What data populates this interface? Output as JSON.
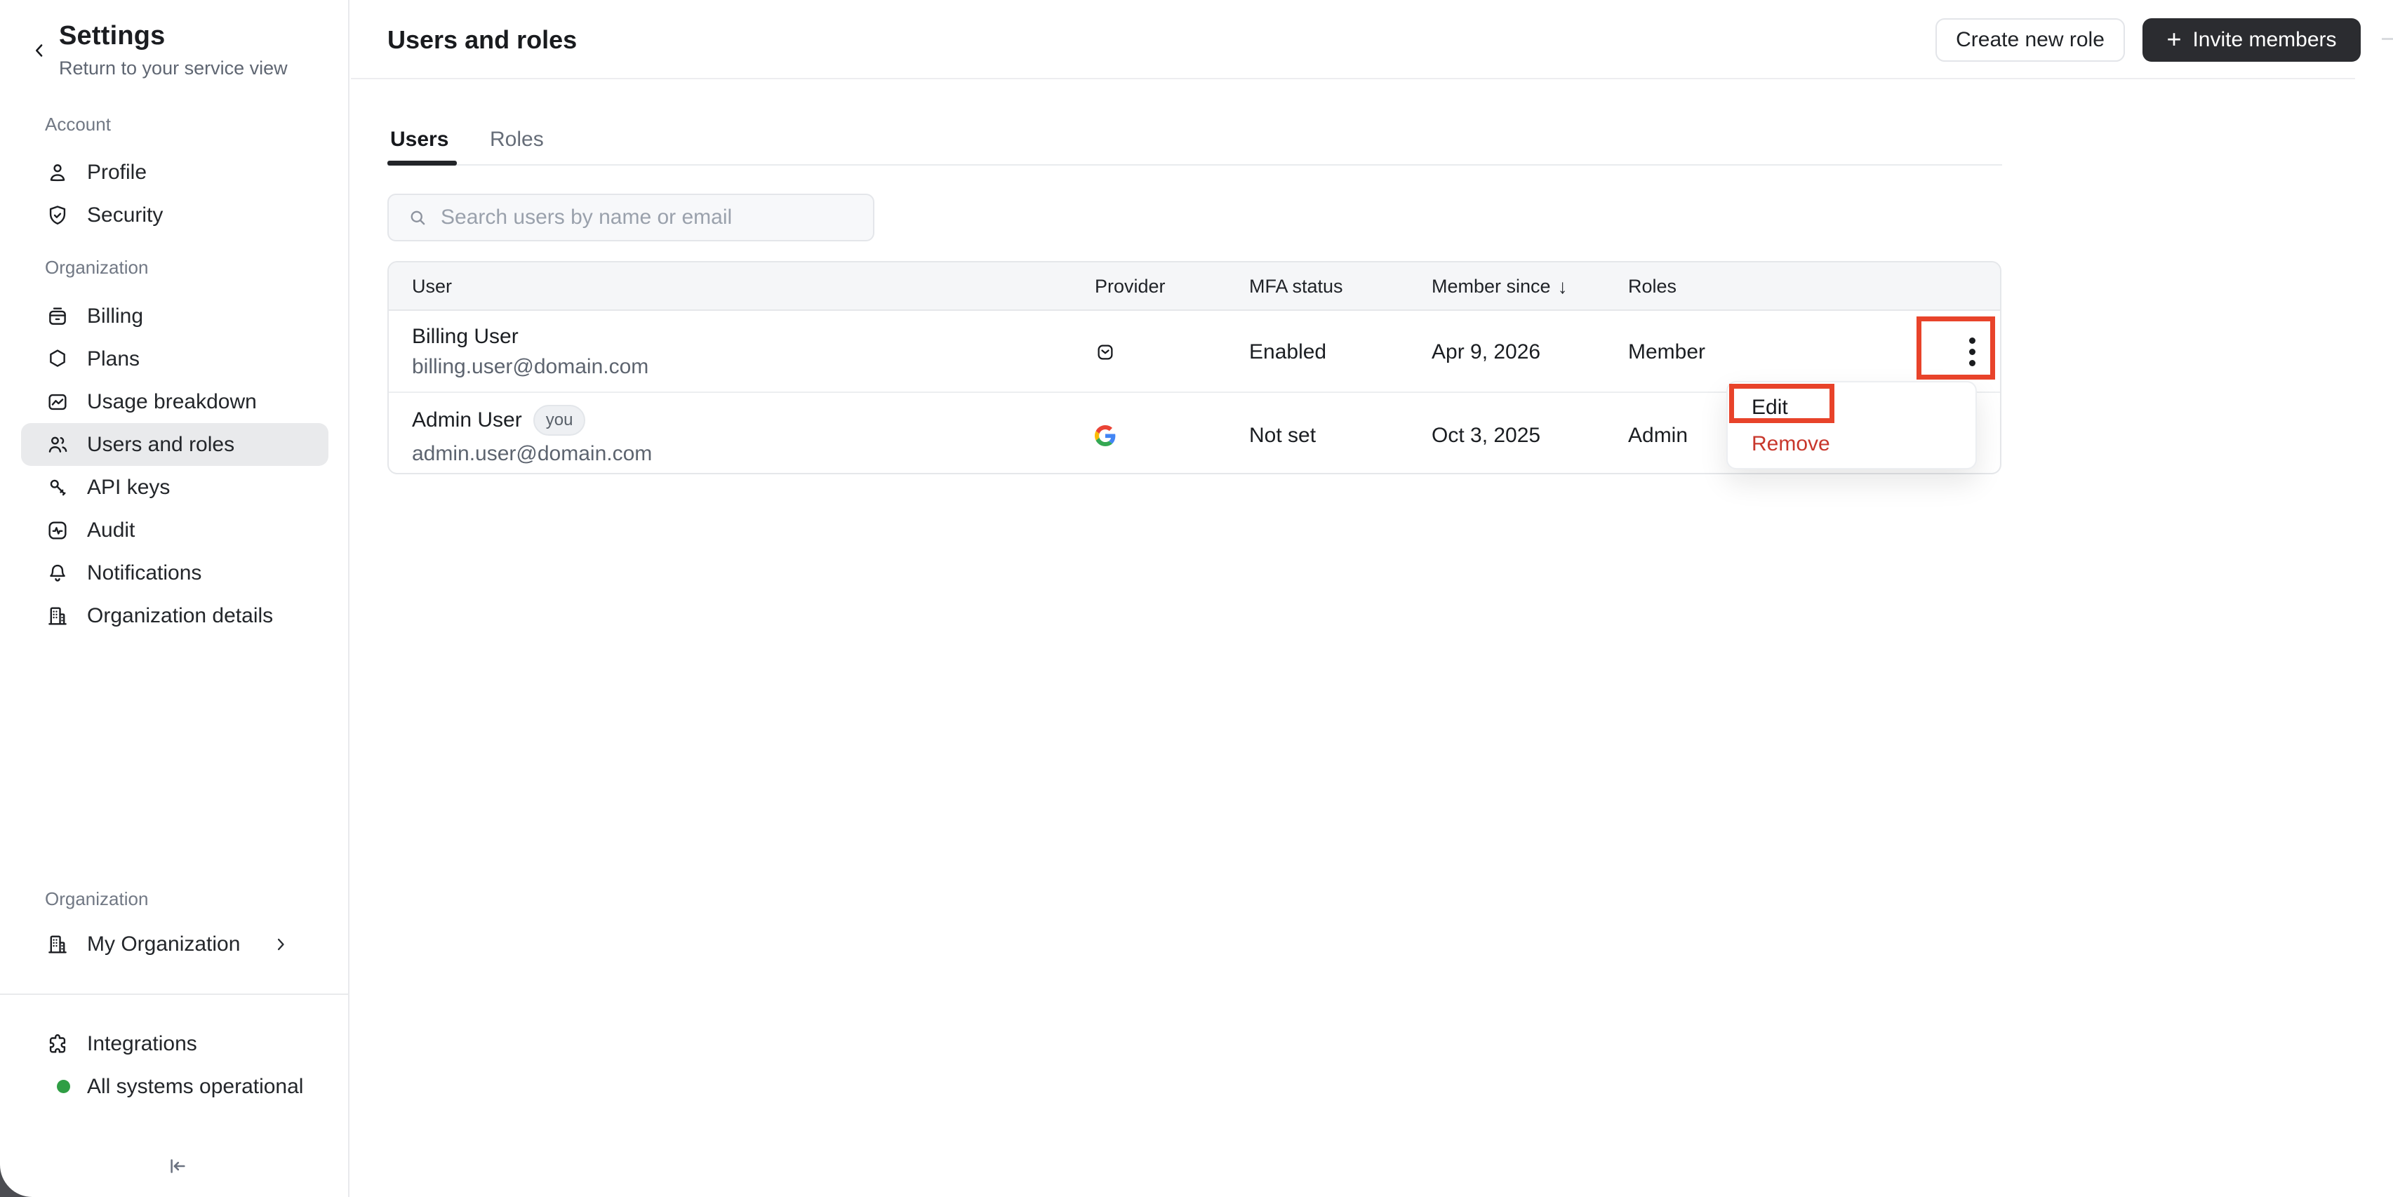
{
  "sidebar": {
    "title": "Settings",
    "subtitle": "Return to your service view",
    "sections": [
      {
        "label": "Account",
        "items": [
          {
            "label": "Profile"
          },
          {
            "label": "Security"
          }
        ]
      },
      {
        "label": "Organization",
        "items": [
          {
            "label": "Billing"
          },
          {
            "label": "Plans"
          },
          {
            "label": "Usage breakdown"
          },
          {
            "label": "Users and roles",
            "selected": true
          },
          {
            "label": "API keys"
          },
          {
            "label": "Audit"
          },
          {
            "label": "Notifications"
          },
          {
            "label": "Organization details"
          }
        ]
      }
    ],
    "bottom": {
      "label": "Organization",
      "org_item": {
        "label": "My Organization"
      },
      "integrations_label": "Integrations",
      "status_label": "All systems operational",
      "status_color": "#2f9e44"
    }
  },
  "header": {
    "title": "Users and roles",
    "create_role_label": "Create new role",
    "invite_label": "Invite members",
    "invite_plus": "+"
  },
  "tabs": [
    {
      "label": "Users",
      "active": true
    },
    {
      "label": "Roles"
    }
  ],
  "search": {
    "placeholder": "Search users by name or email"
  },
  "table": {
    "columns": [
      "User",
      "Provider",
      "MFA status",
      "Member since",
      "Roles"
    ],
    "sort_arrow": "↓",
    "rows": [
      {
        "name": "Billing User",
        "email": "billing.user@domain.com",
        "provider": "email",
        "mfa": "Enabled",
        "member_since": "Apr 9, 2026",
        "roles": "Member"
      },
      {
        "name": "Admin User",
        "badge": "you",
        "email": "admin.user@domain.com",
        "provider": "google",
        "mfa": "Not set",
        "member_since": "Oct 3, 2025",
        "roles": "Admin"
      }
    ]
  },
  "menu": {
    "items": [
      {
        "label": "Edit"
      },
      {
        "label": "Remove",
        "danger": true
      }
    ]
  },
  "annotations": {
    "color": "#e8432a"
  }
}
